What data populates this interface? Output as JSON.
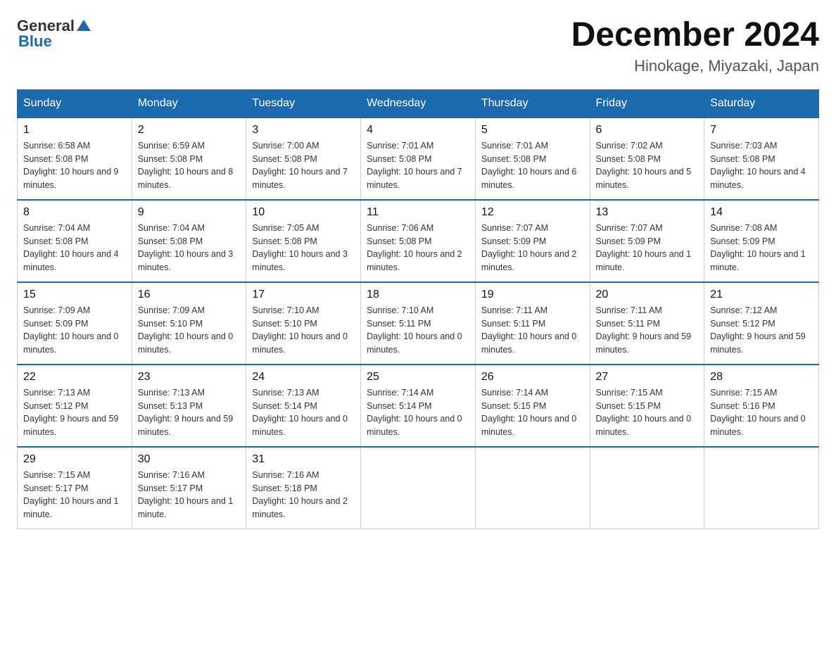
{
  "header": {
    "logo_general": "General",
    "logo_blue": "Blue",
    "month_title": "December 2024",
    "location": "Hinokage, Miyazaki, Japan"
  },
  "days_of_week": [
    "Sunday",
    "Monday",
    "Tuesday",
    "Wednesday",
    "Thursday",
    "Friday",
    "Saturday"
  ],
  "weeks": [
    [
      {
        "day": "1",
        "sunrise": "6:58 AM",
        "sunset": "5:08 PM",
        "daylight": "10 hours and 9 minutes."
      },
      {
        "day": "2",
        "sunrise": "6:59 AM",
        "sunset": "5:08 PM",
        "daylight": "10 hours and 8 minutes."
      },
      {
        "day": "3",
        "sunrise": "7:00 AM",
        "sunset": "5:08 PM",
        "daylight": "10 hours and 7 minutes."
      },
      {
        "day": "4",
        "sunrise": "7:01 AM",
        "sunset": "5:08 PM",
        "daylight": "10 hours and 7 minutes."
      },
      {
        "day": "5",
        "sunrise": "7:01 AM",
        "sunset": "5:08 PM",
        "daylight": "10 hours and 6 minutes."
      },
      {
        "day": "6",
        "sunrise": "7:02 AM",
        "sunset": "5:08 PM",
        "daylight": "10 hours and 5 minutes."
      },
      {
        "day": "7",
        "sunrise": "7:03 AM",
        "sunset": "5:08 PM",
        "daylight": "10 hours and 4 minutes."
      }
    ],
    [
      {
        "day": "8",
        "sunrise": "7:04 AM",
        "sunset": "5:08 PM",
        "daylight": "10 hours and 4 minutes."
      },
      {
        "day": "9",
        "sunrise": "7:04 AM",
        "sunset": "5:08 PM",
        "daylight": "10 hours and 3 minutes."
      },
      {
        "day": "10",
        "sunrise": "7:05 AM",
        "sunset": "5:08 PM",
        "daylight": "10 hours and 3 minutes."
      },
      {
        "day": "11",
        "sunrise": "7:06 AM",
        "sunset": "5:08 PM",
        "daylight": "10 hours and 2 minutes."
      },
      {
        "day": "12",
        "sunrise": "7:07 AM",
        "sunset": "5:09 PM",
        "daylight": "10 hours and 2 minutes."
      },
      {
        "day": "13",
        "sunrise": "7:07 AM",
        "sunset": "5:09 PM",
        "daylight": "10 hours and 1 minute."
      },
      {
        "day": "14",
        "sunrise": "7:08 AM",
        "sunset": "5:09 PM",
        "daylight": "10 hours and 1 minute."
      }
    ],
    [
      {
        "day": "15",
        "sunrise": "7:09 AM",
        "sunset": "5:09 PM",
        "daylight": "10 hours and 0 minutes."
      },
      {
        "day": "16",
        "sunrise": "7:09 AM",
        "sunset": "5:10 PM",
        "daylight": "10 hours and 0 minutes."
      },
      {
        "day": "17",
        "sunrise": "7:10 AM",
        "sunset": "5:10 PM",
        "daylight": "10 hours and 0 minutes."
      },
      {
        "day": "18",
        "sunrise": "7:10 AM",
        "sunset": "5:11 PM",
        "daylight": "10 hours and 0 minutes."
      },
      {
        "day": "19",
        "sunrise": "7:11 AM",
        "sunset": "5:11 PM",
        "daylight": "10 hours and 0 minutes."
      },
      {
        "day": "20",
        "sunrise": "7:11 AM",
        "sunset": "5:11 PM",
        "daylight": "9 hours and 59 minutes."
      },
      {
        "day": "21",
        "sunrise": "7:12 AM",
        "sunset": "5:12 PM",
        "daylight": "9 hours and 59 minutes."
      }
    ],
    [
      {
        "day": "22",
        "sunrise": "7:13 AM",
        "sunset": "5:12 PM",
        "daylight": "9 hours and 59 minutes."
      },
      {
        "day": "23",
        "sunrise": "7:13 AM",
        "sunset": "5:13 PM",
        "daylight": "9 hours and 59 minutes."
      },
      {
        "day": "24",
        "sunrise": "7:13 AM",
        "sunset": "5:14 PM",
        "daylight": "10 hours and 0 minutes."
      },
      {
        "day": "25",
        "sunrise": "7:14 AM",
        "sunset": "5:14 PM",
        "daylight": "10 hours and 0 minutes."
      },
      {
        "day": "26",
        "sunrise": "7:14 AM",
        "sunset": "5:15 PM",
        "daylight": "10 hours and 0 minutes."
      },
      {
        "day": "27",
        "sunrise": "7:15 AM",
        "sunset": "5:15 PM",
        "daylight": "10 hours and 0 minutes."
      },
      {
        "day": "28",
        "sunrise": "7:15 AM",
        "sunset": "5:16 PM",
        "daylight": "10 hours and 0 minutes."
      }
    ],
    [
      {
        "day": "29",
        "sunrise": "7:15 AM",
        "sunset": "5:17 PM",
        "daylight": "10 hours and 1 minute."
      },
      {
        "day": "30",
        "sunrise": "7:16 AM",
        "sunset": "5:17 PM",
        "daylight": "10 hours and 1 minute."
      },
      {
        "day": "31",
        "sunrise": "7:16 AM",
        "sunset": "5:18 PM",
        "daylight": "10 hours and 2 minutes."
      },
      null,
      null,
      null,
      null
    ]
  ]
}
